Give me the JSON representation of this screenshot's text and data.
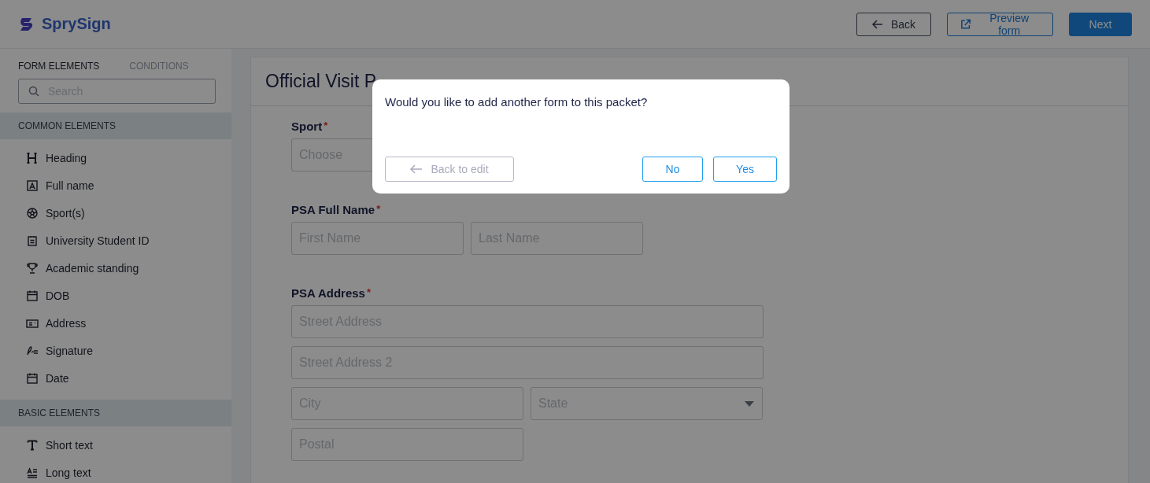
{
  "header": {
    "logo": "SprySign",
    "buttons": [
      {
        "label": "Back",
        "kind": "back"
      },
      {
        "label": "Preview form",
        "kind": "preview"
      },
      {
        "label": "Next",
        "kind": "primary"
      }
    ]
  },
  "sidebar": {
    "tabs": [
      {
        "label": "FORM ELEMENTS",
        "selected": true
      },
      {
        "label": "CONDITIONS",
        "selected": false
      }
    ],
    "search": {
      "placeholder": "Search"
    },
    "sections": [
      {
        "title": "COMMON ELEMENTS",
        "items": [
          {
            "label": "Heading"
          },
          {
            "label": "Full name"
          },
          {
            "label": "Sport(s)"
          },
          {
            "label": "University Student ID"
          },
          {
            "label": "Academic standing"
          },
          {
            "label": "DOB"
          },
          {
            "label": "Address"
          },
          {
            "label": "Signature"
          },
          {
            "label": "Date"
          }
        ]
      },
      {
        "title": "BASIC ELEMENTS",
        "items": [
          {
            "label": "Short text"
          },
          {
            "label": "Long text"
          }
        ]
      }
    ]
  },
  "form": {
    "title": "Official Visit P",
    "fields": [
      {
        "label": "Sport",
        "required_mark": "*",
        "rows": [
          [
            {
              "placeholder": "Choose"
            }
          ]
        ]
      },
      {
        "label": "PSA Full Name",
        "required_mark": "*",
        "rows": [
          [
            {
              "placeholder": "First Name",
              "kind": "text"
            },
            {
              "placeholder": "Last Name",
              "kind": "text"
            }
          ]
        ]
      },
      {
        "label": "PSA Address",
        "required_mark": "*",
        "rows": [
          [
            {
              "placeholder": "Street Address",
              "kind": "text"
            }
          ],
          [
            {
              "placeholder": "Street Address 2",
              "kind": "text"
            }
          ],
          [
            {
              "placeholder": "City",
              "kind": "text"
            },
            {
              "placeholder": "State",
              "kind": "select"
            }
          ],
          [
            {
              "placeholder": "Postal",
              "kind": "text"
            }
          ]
        ]
      }
    ]
  },
  "dialog": {
    "message": "Would you like to add another form to this packet?",
    "back": {
      "label": "Back to edit",
      "disabled": true
    },
    "buttons": [
      "No",
      "Yes"
    ]
  }
}
